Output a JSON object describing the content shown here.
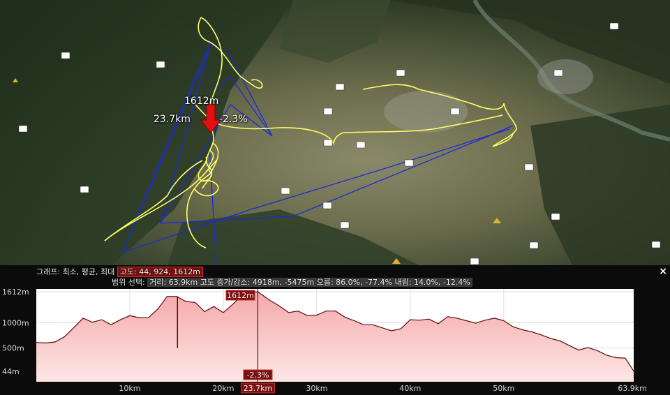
{
  "map": {
    "marker_altitude": "1612m",
    "marker_distance": "23.7km",
    "marker_grade": "-2.3%"
  },
  "graph_panel": {
    "row1_prefix": "그래프: 최소, 평균, 최대",
    "altitude_summary": "고도: 44, 924, 1612m",
    "row2_prefix": "범위 선택:",
    "range_stats": "거리: 63.9km 고도 증가/감소: 4918m, -5475m 오름: 86.0%, -77.4% 내림: 14.0%, -12.4%",
    "close_label": "×"
  },
  "chart_data": {
    "type": "area",
    "x_unit": "km",
    "y_unit": "m",
    "xlim": [
      0,
      63.9
    ],
    "ylim": [
      0,
      1612
    ],
    "y_ticks": [
      "1612m",
      "1000m",
      "500m",
      "44m"
    ],
    "x_ticks": [
      "10km",
      "20km",
      "30km",
      "40km",
      "50km",
      "63.9km"
    ],
    "cursor_x_label": "23.7km",
    "cursor_altitude_label": "1612m",
    "cursor_grade_label": "-2.3%",
    "x": [
      0,
      1,
      2,
      3,
      4,
      5,
      6,
      7,
      8,
      9,
      10,
      11,
      12,
      13,
      14,
      15,
      16,
      17,
      18,
      19,
      20,
      21,
      22,
      23,
      23.7,
      24,
      25,
      26,
      27,
      28,
      29,
      30,
      31,
      32,
      33,
      34,
      35,
      36,
      37,
      38,
      39,
      40,
      41,
      42,
      43,
      44,
      45,
      46,
      47,
      48,
      49,
      50,
      51,
      52,
      53,
      54,
      55,
      56,
      57,
      58,
      59,
      60,
      61,
      62,
      63,
      63.9
    ],
    "y": [
      610,
      600,
      620,
      720,
      900,
      1090,
      1010,
      1060,
      960,
      1060,
      1140,
      1100,
      1100,
      1270,
      1520,
      1520,
      1420,
      1400,
      1220,
      1320,
      1200,
      1360,
      1540,
      1600,
      1612,
      1570,
      1440,
      1330,
      1200,
      1230,
      1140,
      1150,
      1230,
      1230,
      1110,
      1040,
      960,
      960,
      900,
      840,
      880,
      1060,
      1050,
      1070,
      980,
      1120,
      1090,
      1040,
      990,
      1050,
      1090,
      1040,
      920,
      860,
      820,
      760,
      690,
      640,
      550,
      460,
      510,
      450,
      360,
      310,
      300,
      44
    ],
    "colors": {
      "profile_line": "#5a0a0a",
      "fill_top": "#f7b6b6",
      "fill_bottom": "#fce4e4",
      "cursor": "#000000",
      "axis_box": "#7a1010"
    }
  },
  "map_track": {
    "colors": {
      "gps_track": "#ffff66",
      "straight_segments": "#1a2bd6",
      "marker": "#e41010"
    }
  }
}
